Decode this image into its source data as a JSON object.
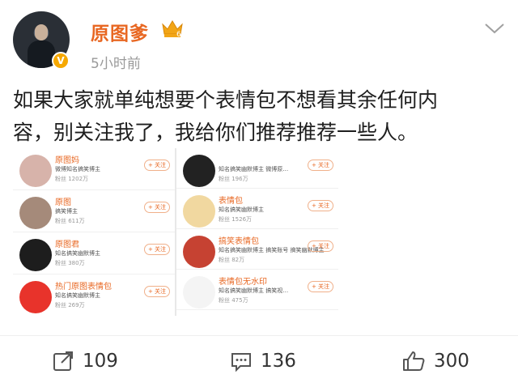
{
  "author": {
    "name": "原图爹",
    "time": "5小时前",
    "verified_badge": "V",
    "level_badge": "6"
  },
  "post": {
    "text_line1": "如果大家就单纯想要个表情包不想看其余任何内",
    "text_line2": "容，别关注我了，我给你们推荐推荐一些人。"
  },
  "screenshot": {
    "left": [
      {
        "name": "原图妈",
        "desc": "微博知名搞笑博主",
        "fans": "粉丝  1202万",
        "follow": "+ 关注",
        "avatar_color": "#d7b3aa"
      },
      {
        "name": "原图",
        "desc": "搞笑博主",
        "fans": "粉丝  611万",
        "follow": "+ 关注",
        "avatar_color": "#a58a7a"
      },
      {
        "name": "原图君",
        "desc": "知名搞笑幽默博主",
        "fans": "粉丝  380万",
        "follow": "+ 关注",
        "avatar_color": "#1d1d1d"
      },
      {
        "name": "热门原图表情包",
        "desc": "知名搞笑幽默博主",
        "fans": "粉丝  269万",
        "follow": "+ 关注",
        "avatar_color": "#e8332b"
      }
    ],
    "right": [
      {
        "name": "",
        "desc": "知名搞笑幽默博主  微博原…",
        "fans": "粉丝  196万",
        "follow": "+ 关注",
        "avatar_color": "#222222"
      },
      {
        "name": "表情包",
        "desc": "知名搞笑幽默博主",
        "fans": "粉丝  1526万",
        "follow": "+ 关注",
        "avatar_color": "#f1d8a0"
      },
      {
        "name": "搞笑表情包",
        "desc": "知名搞笑幽默博主  搞笑账号  搞笑幽默博主",
        "fans": "粉丝  82万",
        "follow": "+ 关注",
        "avatar_color": "#c64232"
      },
      {
        "name": "表情包无水印",
        "desc": "知名搞笑幽默博主  搞笑视…",
        "fans": "粉丝  475万",
        "follow": "+ 关注",
        "avatar_color": "#f4f4f4"
      }
    ]
  },
  "actions": {
    "repost_count": "109",
    "comment_count": "136",
    "like_count": "300"
  },
  "colors": {
    "accent": "#e86722",
    "text": "#1e1e1e",
    "muted": "#9a9a9a"
  }
}
